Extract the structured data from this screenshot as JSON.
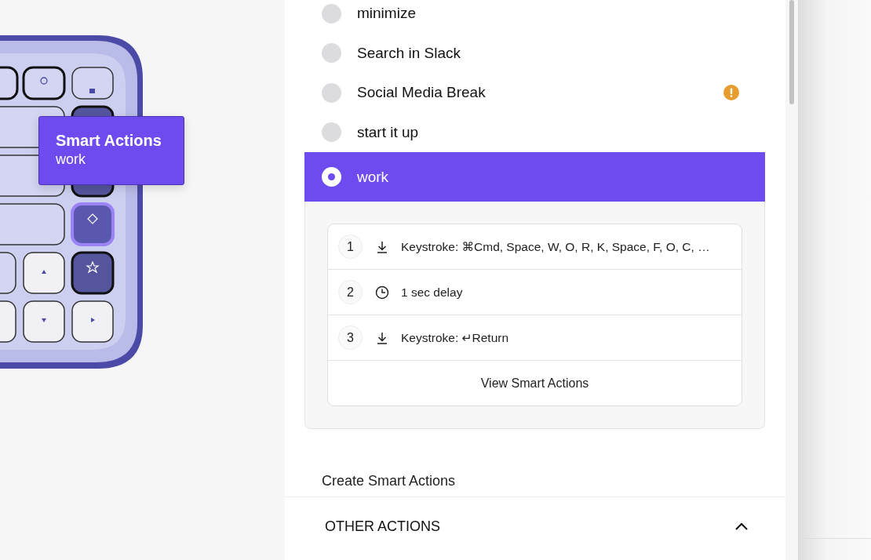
{
  "tooltip": {
    "title": "Smart Actions",
    "subtitle": "work"
  },
  "actions": [
    {
      "label": "minimize",
      "selected": false,
      "warning": false
    },
    {
      "label": "Search in Slack",
      "selected": false,
      "warning": false
    },
    {
      "label": "Social Media Break",
      "selected": false,
      "warning": true
    },
    {
      "label": "start it up",
      "selected": false,
      "warning": false
    },
    {
      "label": "work",
      "selected": true,
      "warning": false,
      "steps": [
        {
          "number": "1",
          "kind": "keystroke",
          "text": "Keystroke: ⌘Cmd, Space, W, O, R, K, Space, F, O, C, …"
        },
        {
          "number": "2",
          "kind": "delay",
          "text": "1 sec delay"
        },
        {
          "number": "3",
          "kind": "keystroke",
          "text": "Keystroke: ↵Return"
        }
      ],
      "view_link": "View Smart Actions"
    }
  ],
  "create_link": "Create Smart Actions",
  "other_actions": {
    "title": "OTHER ACTIONS",
    "expanded": true
  }
}
